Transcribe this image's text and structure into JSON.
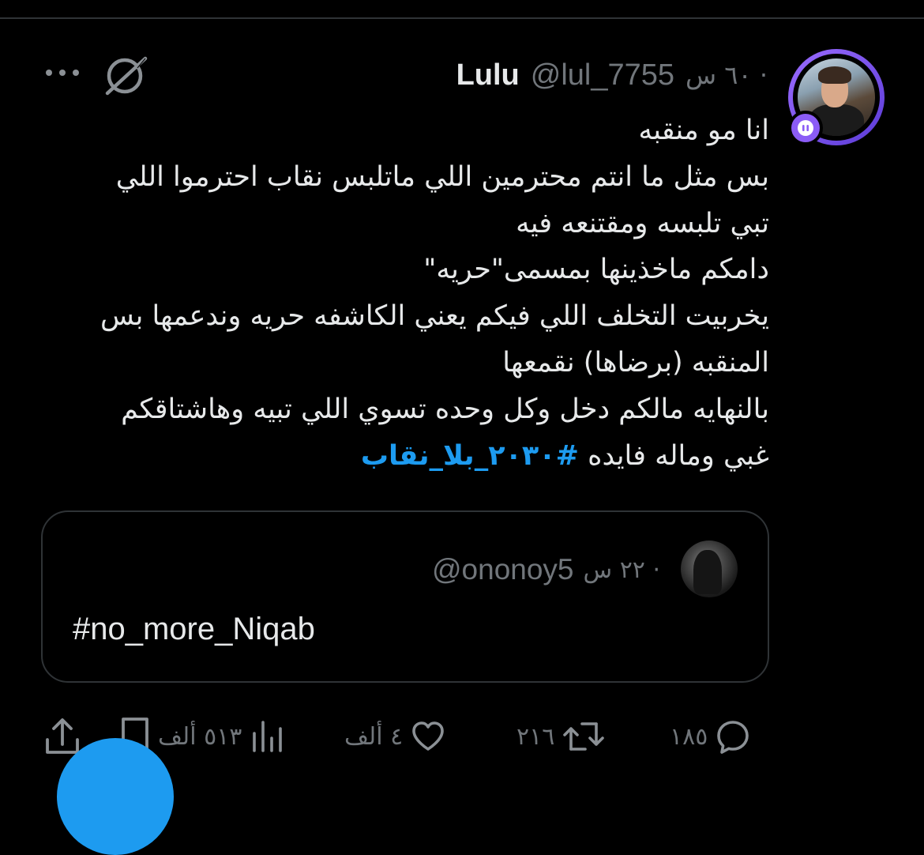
{
  "tweet": {
    "author_name": "Lulu",
    "handle": "@lul_7755",
    "time": "· ٦٠ س",
    "lines": [
      "انا مو منقبه",
      "بس مثل ما انتم محترمين اللي ماتلبس نقاب احترموا اللي",
      "تبي تلبسه ومقتنعه فيه",
      " دامكم ماخذينها بمسمى\"حريه\"",
      " يخربيت التخلف اللي فيكم يعني الكاشفه حريه وندعمها بس",
      "المنقبه (برضاها) نقمعها",
      "بالنهايه مالكم دخل وكل وحده تسوي اللي تبيه وهاشتاقكم"
    ],
    "last_line_text": "غبي وماله فايده ",
    "hashtag": "#٢٠٣٠_بلا_نقاب"
  },
  "quoted": {
    "handle": "@ononoy5",
    "time": "· ٢٢ س",
    "text": "#no_more_Niqab"
  },
  "actions": {
    "replies": "١٨٥",
    "reposts": "٢١٦",
    "likes": "٤ ألف",
    "views": "٥١٣ ألف"
  },
  "icons": {
    "accent": "#1d9bf0",
    "muted": "#71767b",
    "spaces_badge": "#8b5cf6"
  }
}
